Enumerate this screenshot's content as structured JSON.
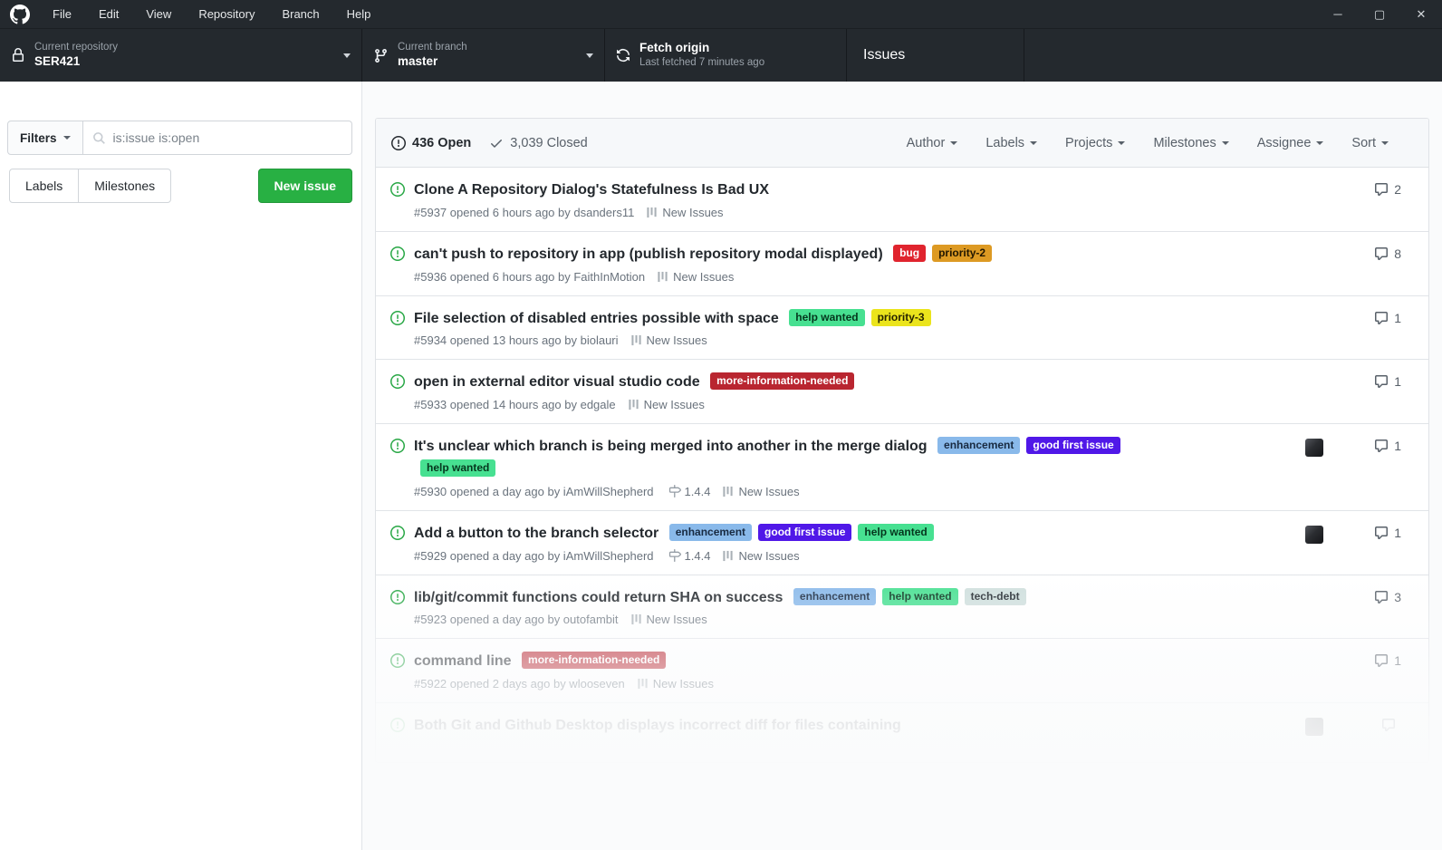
{
  "window": {
    "menu_items": [
      "File",
      "Edit",
      "View",
      "Repository",
      "Branch",
      "Help"
    ],
    "minimize": "─",
    "maximize": "▢",
    "close": "✕"
  },
  "toolbar": {
    "repo_label": "Current repository",
    "repo_value": "SER421",
    "branch_label": "Current branch",
    "branch_value": "master",
    "fetch_label": "Fetch origin",
    "fetch_sub": "Last fetched 7 minutes ago",
    "tab_label": "Issues"
  },
  "sidebar": {
    "filters_label": "Filters",
    "search_value": "is:issue is:open",
    "labels_btn": "Labels",
    "milestones_btn": "Milestones",
    "new_issue_btn": "New issue"
  },
  "list_header": {
    "open_label": "436 Open",
    "closed_label": "3,039 Closed",
    "dropdowns": [
      "Author",
      "Labels",
      "Projects",
      "Milestones",
      "Assignee",
      "Sort"
    ]
  },
  "issues": [
    {
      "title": "Clone A Repository Dialog's Statefulness Is Bad UX",
      "labels": [],
      "meta": "#5937 opened 6 hours ago by dsanders11",
      "project": "New Issues",
      "comments": "2",
      "avatar": false
    },
    {
      "title": "can't push to repository in app (publish repository modal displayed)",
      "labels": [
        {
          "text": "bug",
          "bg": "#e0242e",
          "fg": "#ffffff"
        },
        {
          "text": "priority-2",
          "bg": "#dd9a23",
          "fg": "#211600"
        }
      ],
      "meta": "#5936 opened 6 hours ago by FaithInMotion",
      "project": "New Issues",
      "comments": "8",
      "avatar": false
    },
    {
      "title": "File selection of disabled entries possible with space",
      "labels": [
        {
          "text": "help wanted",
          "bg": "#47e091",
          "fg": "#05361d"
        },
        {
          "text": "priority-3",
          "bg": "#ebe41c",
          "fg": "#272300"
        }
      ],
      "meta": "#5934 opened 13 hours ago by biolauri",
      "project": "New Issues",
      "comments": "1",
      "avatar": false
    },
    {
      "title": "open in external editor visual studio code",
      "labels": [
        {
          "text": "more-information-needed",
          "bg": "#b92630",
          "fg": "#ffffff"
        }
      ],
      "meta": "#5933 opened 14 hours ago by edgale",
      "project": "New Issues",
      "comments": "1",
      "avatar": false
    },
    {
      "title": "It's unclear which branch is being merged into another in the merge dialog",
      "labels": [
        {
          "text": "enhancement",
          "bg": "#89b9ea",
          "fg": "#182a41"
        },
        {
          "text": "good first issue",
          "bg": "#5018e8",
          "fg": "#ffffff"
        },
        {
          "text": "help wanted",
          "bg": "#47e091",
          "fg": "#05361d"
        }
      ],
      "meta": "#5930 opened a day ago by iAmWillShepherd",
      "milestone": "1.4.4",
      "project": "New Issues",
      "comments": "1",
      "avatar": true
    },
    {
      "title": "Add a button to the branch selector",
      "labels": [
        {
          "text": "enhancement",
          "bg": "#89b9ea",
          "fg": "#182a41"
        },
        {
          "text": "good first issue",
          "bg": "#5018e8",
          "fg": "#ffffff"
        },
        {
          "text": "help wanted",
          "bg": "#47e091",
          "fg": "#05361d"
        }
      ],
      "meta": "#5929 opened a day ago by iAmWillShepherd",
      "milestone": "1.4.4",
      "project": "New Issues",
      "comments": "1",
      "avatar": true
    },
    {
      "title": "lib/git/commit functions could return SHA on success",
      "labels": [
        {
          "text": "enhancement",
          "bg": "#89b9ea",
          "fg": "#182a41"
        },
        {
          "text": "help wanted",
          "bg": "#47e091",
          "fg": "#05361d"
        },
        {
          "text": "tech-debt",
          "bg": "#cfdfdd",
          "fg": "#21282e"
        }
      ],
      "meta": "#5923 opened a day ago by outofambit",
      "project": "New Issues",
      "comments": "3",
      "avatar": false
    },
    {
      "title": "command line",
      "labels": [
        {
          "text": "more-information-needed",
          "bg": "#b92630",
          "fg": "#ffffff"
        }
      ],
      "meta": "#5922 opened 2 days ago by wlooseven",
      "project": "New Issues",
      "comments": "1",
      "avatar": false
    },
    {
      "title": "Both Git and Github Desktop displays incorrect diff for files containing",
      "labels": [],
      "meta": "",
      "project": "",
      "comments": "",
      "avatar": true,
      "ghost": true
    }
  ]
}
